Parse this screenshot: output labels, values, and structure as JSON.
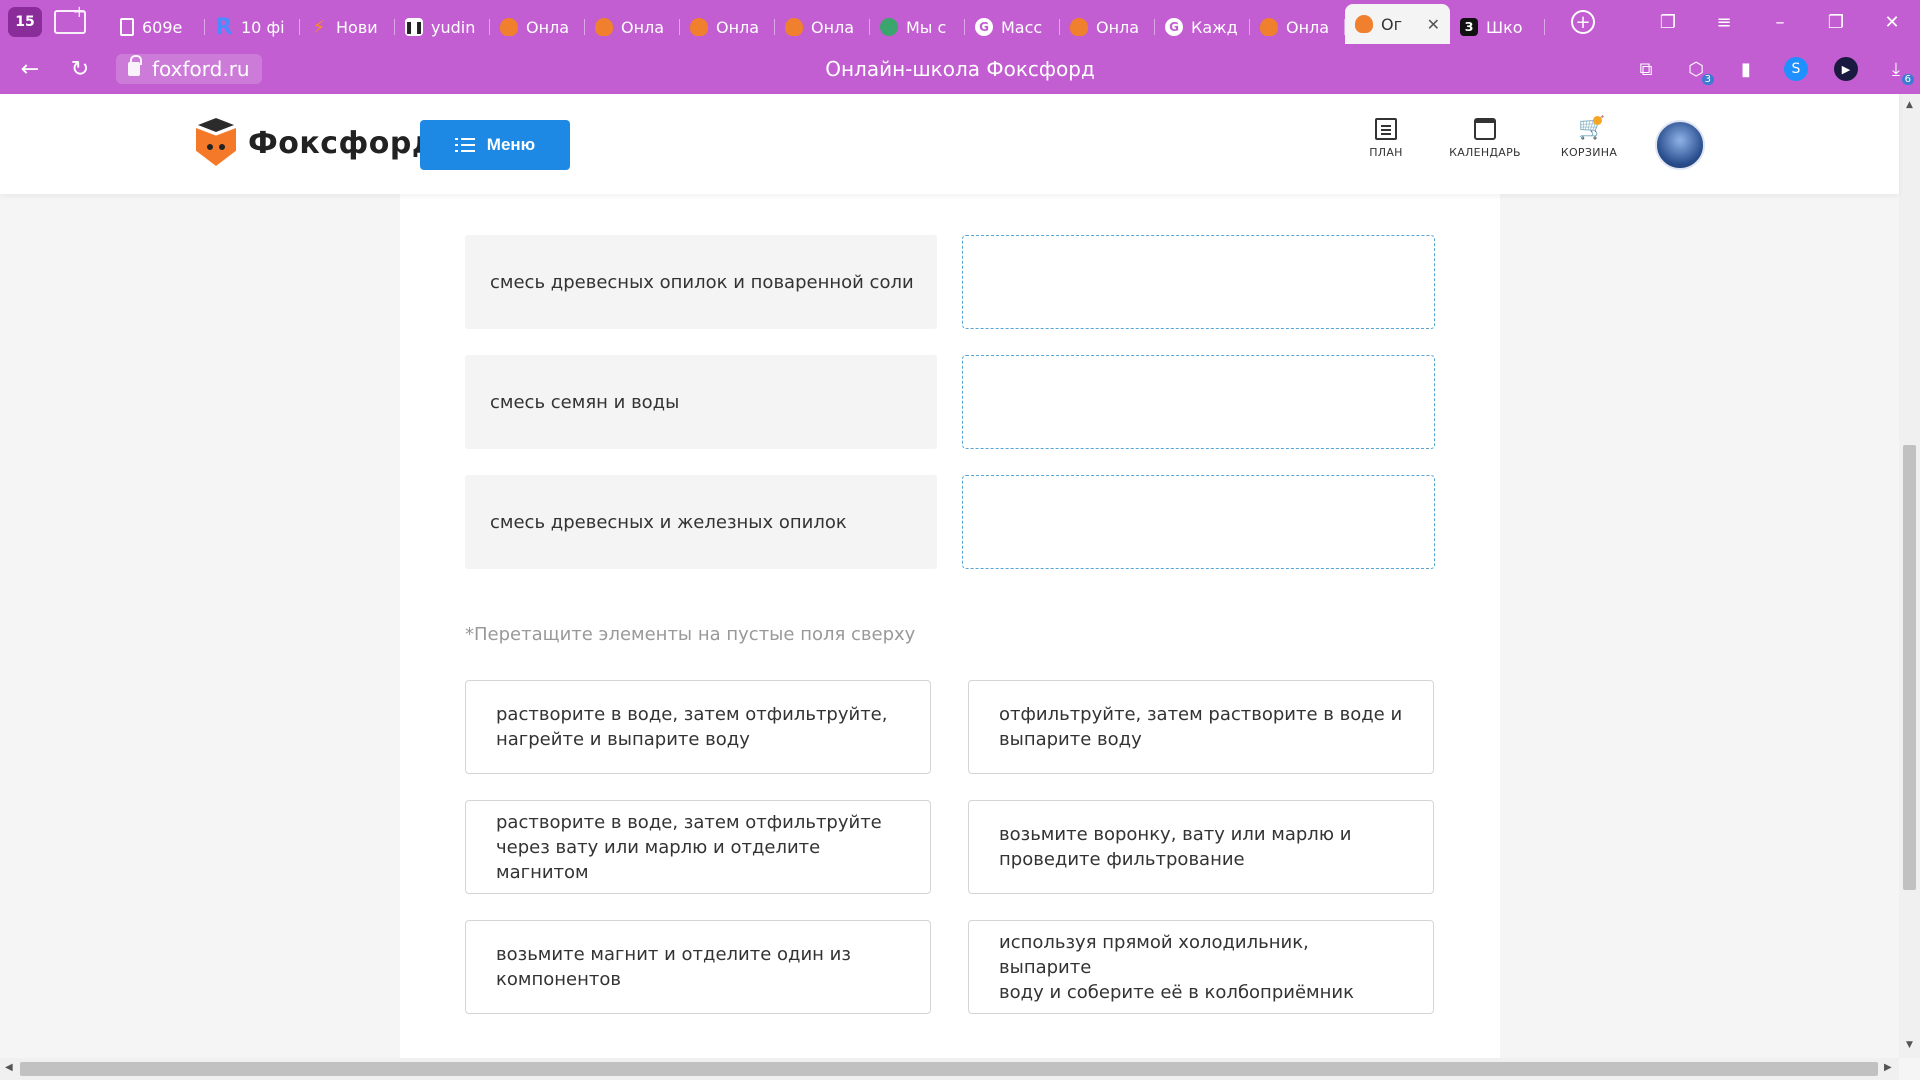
{
  "browser": {
    "tab_count": "15",
    "tabs": [
      {
        "label": "609e",
        "icon": "doc-icon"
      },
      {
        "label": "10 фі",
        "icon": "r-icon"
      },
      {
        "label": "Нови",
        "icon": "bolt-icon"
      },
      {
        "label": "yudin",
        "icon": "pause-icon"
      },
      {
        "label": "Онла",
        "icon": "fox-icon"
      },
      {
        "label": "Онла",
        "icon": "fox-icon"
      },
      {
        "label": "Онла",
        "icon": "fox-icon"
      },
      {
        "label": "Онла",
        "icon": "fox-icon"
      },
      {
        "label": "Мы с",
        "icon": "globe-icon"
      },
      {
        "label": "Масс",
        "icon": "g-icon"
      },
      {
        "label": "Онла",
        "icon": "fox-icon"
      },
      {
        "label": "Кажд",
        "icon": "g-icon"
      },
      {
        "label": "Онла",
        "icon": "fox-icon"
      },
      {
        "label": "Ог",
        "icon": "fox-icon",
        "active": true
      },
      {
        "label": "Шко",
        "icon": "z-icon"
      }
    ],
    "url": "foxford.ru",
    "page_title": "Онлайн-школа Фоксфорд",
    "download_badge": "6",
    "extension_badge": "3",
    "accent_color": "#c25ed1"
  },
  "header": {
    "logo_text": "Фоксфорд",
    "menu_label": "Меню",
    "links": [
      {
        "label": "ПЛАН",
        "icon": "plan-icon"
      },
      {
        "label": "КАЛЕНДАРЬ",
        "icon": "calendar-icon"
      },
      {
        "label": "КОРЗИНА",
        "icon": "cart-icon"
      }
    ],
    "menu_button_color": "#1e88e5"
  },
  "task": {
    "pairs": [
      {
        "term": "смесь древесных опилок и поваренной соли"
      },
      {
        "term": "смесь семян и воды"
      },
      {
        "term": "смесь древесных и железных опилок"
      }
    ],
    "hint": "*Перетащите элементы на пустые поля сверху",
    "choices": [
      {
        "line1": "растворите в воде, затем отфильтруйте,",
        "line2": "нагрейте и выпарите воду"
      },
      {
        "line1": "отфильтруйте, затем растворите в воде и",
        "line2": "выпарите воду"
      },
      {
        "line1": "растворите в воде, затем отфильтруйте",
        "line2": "через вату или марлю и отделите магнитом"
      },
      {
        "line1": "возьмите воронку, вату или марлю и",
        "line2": "проведите фильтрование"
      },
      {
        "line1": "возьмите магнит и отделите один из",
        "line2": "компонентов"
      },
      {
        "line1": "используя прямой холодильник, выпарите",
        "line2": "воду и соберите её в колбоприёмник"
      }
    ]
  }
}
